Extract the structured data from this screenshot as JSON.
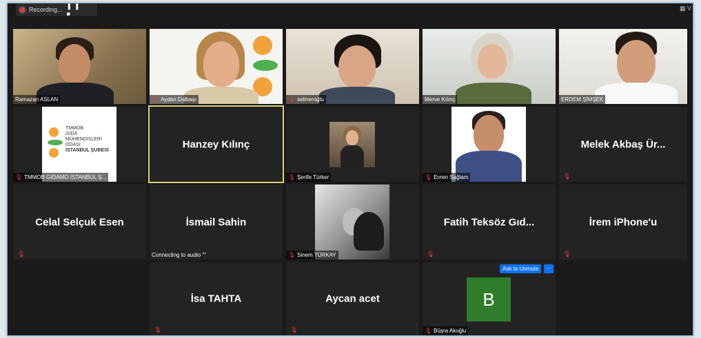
{
  "recording": {
    "label": "Recording...",
    "controls": "❚❚ ■"
  },
  "view_button": "▦ V",
  "tiles": {
    "ramazan": {
      "name": "Ramazan ASLAN"
    },
    "aydan": {
      "name": "Aydan Dalbaşı"
    },
    "selin": {
      "name": "selineroğlu"
    },
    "merve": {
      "name": "Merve Kılınç"
    },
    "erdem": {
      "name": "ERDEM ŞİMŞEK"
    },
    "tmmob": {
      "name": "TMMOB GIDAMO İSTANBUL Ş...",
      "logo_lines": [
        "TMMOB",
        "GIDA",
        "MÜHENDİSLERİ",
        "ODASI",
        "İSTANBUL ŞUBESİ"
      ]
    },
    "hanzey": {
      "name": "Hanzey Kılınç"
    },
    "serife": {
      "name": "Şerife Türker"
    },
    "evren": {
      "name": "Evren Sağlam"
    },
    "melek": {
      "name": "Melek Akbaş Ür..."
    },
    "celal": {
      "name": "Celal Selçuk Esen"
    },
    "ismail": {
      "name": "İsmail Sahin",
      "status": "Connecting to audio \"\""
    },
    "sinem": {
      "name": "Sinem TÜRKAY"
    },
    "fatih": {
      "name": "Fatih Teksöz Gıd..."
    },
    "irem": {
      "name": "İrem iPhone'u"
    },
    "isa": {
      "name": "İsa TAHTA"
    },
    "aycan": {
      "name": "Aycan acet"
    },
    "busra": {
      "name": "Büşra Akoğlu",
      "initial": "B",
      "ask_label": "Ask to Unmute",
      "more_label": "···"
    }
  },
  "colors": {
    "mute": "#e53935",
    "active_border": "#d8d470",
    "unmute_btn": "#0e72ed",
    "avatar_bg": "#2f7d2b"
  }
}
